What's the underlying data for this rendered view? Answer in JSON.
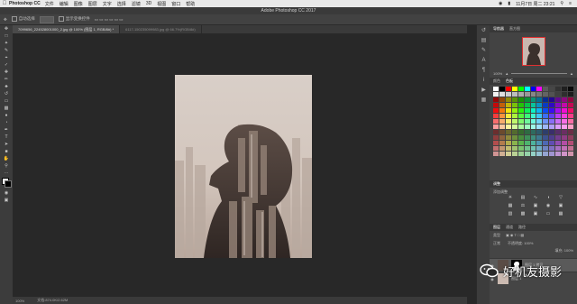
{
  "menubar": {
    "app_name": "Photoshop CC",
    "items": [
      "文件",
      "编辑",
      "图像",
      "图层",
      "文字",
      "选择",
      "滤镜",
      "3D",
      "视图",
      "窗口",
      "帮助"
    ],
    "clock": "11月7日 周二 23:21"
  },
  "window": {
    "title": "Adobe Photoshop CC 2017"
  },
  "options_bar": {
    "tool_label": "自动选择",
    "dropdown_value": "图层",
    "show_transform_label": "显示变换控件"
  },
  "tabs": [
    {
      "label": "7099656_224528001000_2.jpg @ 100% (图层 1, RGB/8#) *"
    },
    {
      "label": "6117-150235099983.jpg @ 66.7%(RGB/8#)"
    }
  ],
  "status": {
    "zoom": "100%",
    "doc": "文档:874.0K/2.62M"
  },
  "panels": {
    "navigator_tabs": [
      "导航器",
      "直方图"
    ],
    "nav_zoom": "100%",
    "swatch_tabs": [
      "颜色",
      "色板"
    ],
    "adjust_tab": "调整",
    "adjust_title": "添加调整",
    "layer_tabs": [
      "图层",
      "通道",
      "路径"
    ],
    "layer_kind": "类型",
    "blend_mode": "正常",
    "opacity_label": "不透明度: 100%",
    "fill_label": "填充: 100%",
    "layers": [
      {
        "name": "图层 1 拷贝"
      },
      {
        "name": "图层 1"
      }
    ]
  },
  "watermark": {
    "text": "好机友摄影"
  },
  "colors": {
    "accent_border": "#e03030",
    "swatch_palette": [
      "#ffffff",
      "#000000",
      "#ff0000",
      "#ffff00",
      "#00ff00",
      "#00ffff",
      "#0000ff",
      "#ff00ff"
    ]
  }
}
